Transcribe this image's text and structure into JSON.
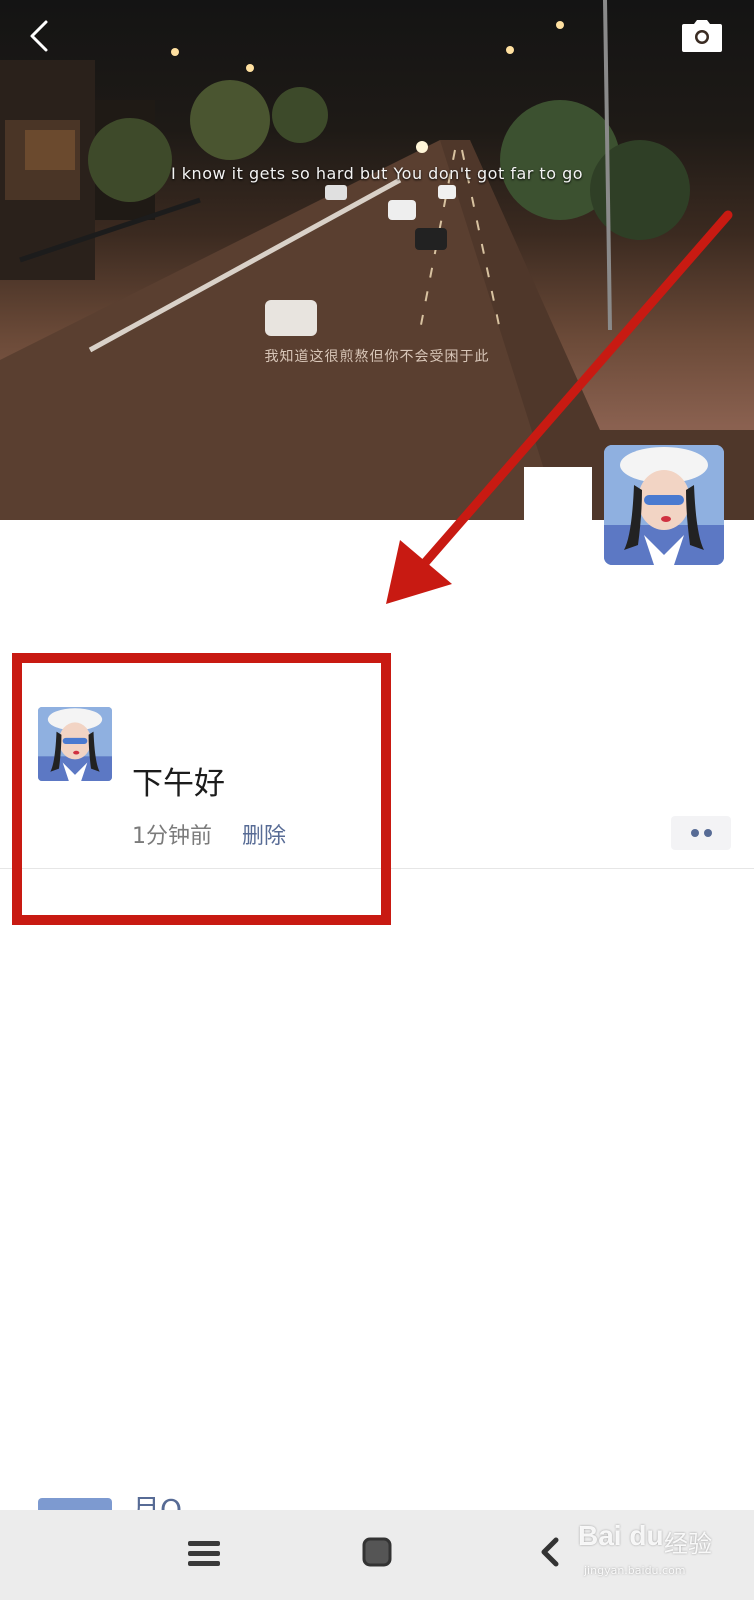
{
  "cover": {
    "caption_en": "I know it gets so hard but You don't got far to go",
    "caption_cn": "我知道这很煎熬但你不会受困于此"
  },
  "header": {
    "back_icon": "chevron-left-icon",
    "camera_icon": "camera-icon"
  },
  "post": {
    "text": "下午好",
    "time": "1分钟前",
    "delete_label": "删除",
    "more_icon": "more-dots-icon"
  },
  "next_post": {
    "name_partial": "月O"
  },
  "navbar": {
    "menu_icon": "menu-icon",
    "home_icon": "home-square-icon",
    "back_icon": "back-chevron-icon"
  },
  "watermark": {
    "logo": "Bai du",
    "cn": "经验",
    "url": "jingyan.baidu.com"
  },
  "colors": {
    "highlight": "#c81a12",
    "link": "#576b95"
  }
}
